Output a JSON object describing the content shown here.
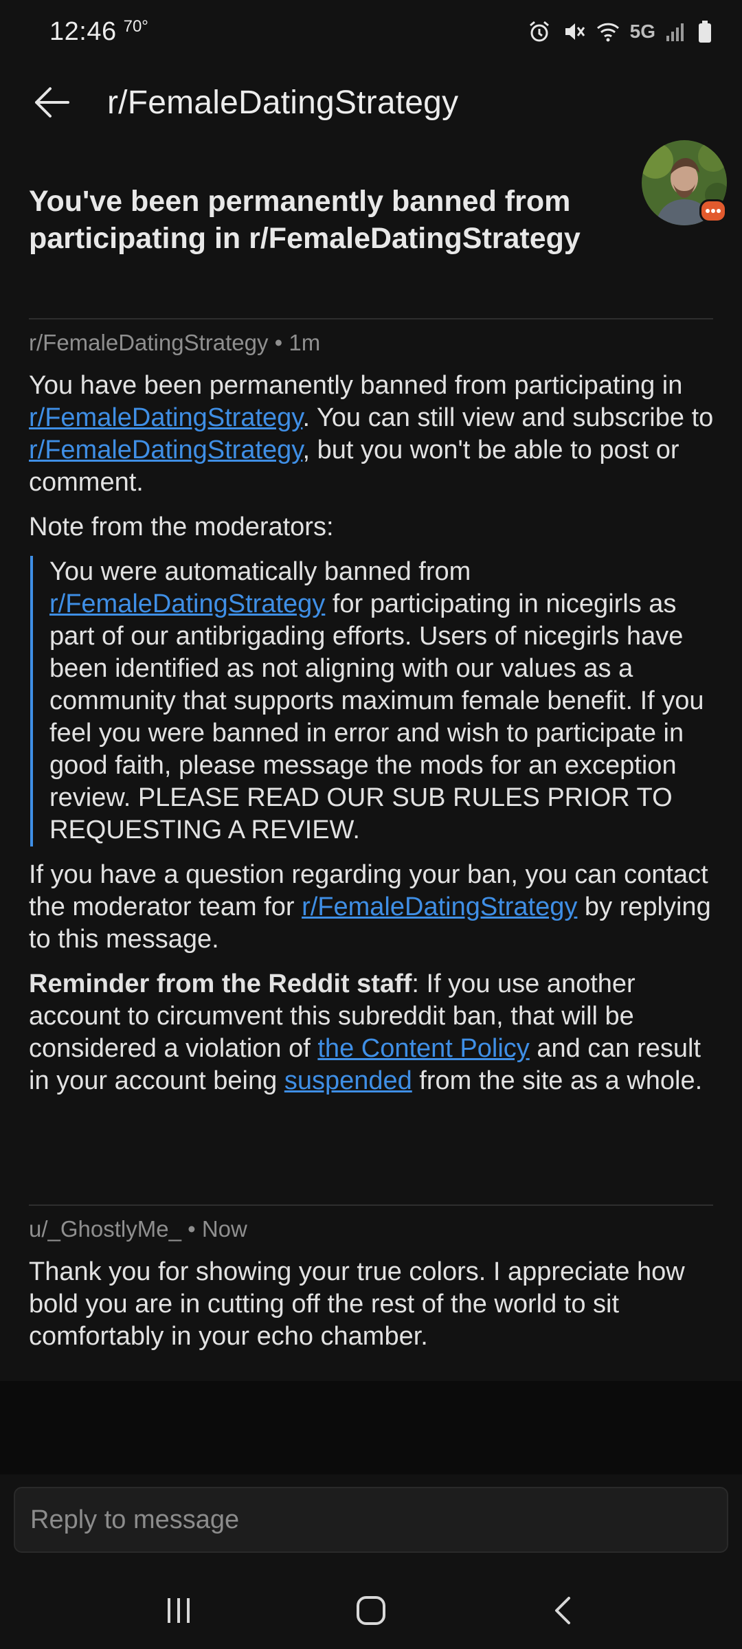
{
  "status": {
    "time": "12:46",
    "temperature": "70°",
    "network": "5G"
  },
  "header": {
    "title": "r/FemaleDatingStrategy"
  },
  "page_title": "You've been permanently banned from participating in r/FemaleDatingStrategy",
  "message1": {
    "author": "r/FemaleDatingStrategy",
    "time": "1m",
    "p1_a": "You have been permanently banned from participating in ",
    "p1_link1": "r/FemaleDatingStrategy",
    "p1_b": ". You can still view and subscribe to ",
    "p1_link2": "r/FemaleDatingStrategy",
    "p1_c": ", but you won't be able to post or comment.",
    "note_label": "Note from the moderators:",
    "quote_a": "You were automatically banned from ",
    "quote_link": "r/FemaleDatingStrategy",
    "quote_b": " for participating in nicegirls as part of our antibrigading efforts. Users of nicegirls have been identified as not aligning with our values as a community that supports maximum female benefit. If you feel you were banned in error and wish to participate in good faith, please message the mods for an exception review. PLEASE READ OUR SUB RULES PRIOR TO REQUESTING A REVIEW.",
    "p3_a": "If you have a question regarding your ban, you can contact the moderator team for ",
    "p3_link": "r/FemaleDatingStrategy",
    "p3_b": " by replying to this message.",
    "reminder_label": "Reminder from the Reddit staff",
    "p4_a": ": If you use another account to circumvent this subreddit ban, that will be considered a violation of ",
    "p4_link1": "the Content Policy",
    "p4_b": " and can result in your account being ",
    "p4_link2": "suspended",
    "p4_c": " from the site as a whole."
  },
  "message2": {
    "author": "u/_GhostlyMe_",
    "time": "Now",
    "body": "Thank you for showing your true colors. I appreciate how bold you are in cutting off the rest of the world to sit comfortably in your echo chamber."
  },
  "reply": {
    "placeholder": "Reply to message"
  },
  "icons": {
    "back": "arrow-left-icon",
    "alarm": "alarm-icon",
    "mute": "mute-icon",
    "wifi": "wifi-icon",
    "signal": "signal-icon",
    "battery": "battery-icon",
    "recents": "recents-icon",
    "home": "home-icon",
    "nav_back": "chevron-left-icon"
  },
  "colors": {
    "background": "#121212",
    "link": "#3f8fe6",
    "badge": "#e25a2e"
  }
}
